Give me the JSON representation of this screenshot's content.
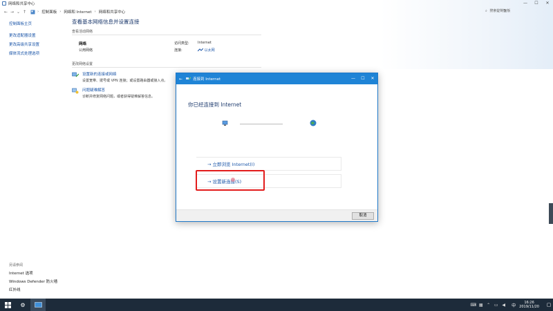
{
  "window": {
    "title": "网络和共享中心",
    "controls": {
      "minimize": "—",
      "maximize": "☐",
      "close": "✕"
    }
  },
  "address": {
    "back": "←",
    "forward": "→",
    "recent": "⌄",
    "up": "↑",
    "path": [
      "控制面板",
      "网络和 Internet",
      "网络和共享中心"
    ],
    "separator": "›",
    "dropdown": "⌄",
    "refresh": "↻",
    "search_placeholder": "搜索控制面板"
  },
  "sidebar": {
    "home": "控制面板主页",
    "items": [
      "更改适配器设置",
      "更改高级共享设置",
      "媒体流式处理选项"
    ],
    "see_also_title": "另请参阅",
    "see_also": [
      "Internet 选项",
      "Windows Defender 防火墙",
      "红外线"
    ]
  },
  "main": {
    "title": "查看基本网络信息并设置连接",
    "active_label": "查看活动网络",
    "network_name": "网络",
    "network_type": "公用网络",
    "access_type_key": "访问类型:",
    "access_type_value": "Internet",
    "connection_key": "连接:",
    "connection_value": "以太网",
    "change_label": "更改网络设置",
    "tasks": [
      {
        "title": "设置新的连接或网络",
        "desc": "设置宽带、拨号或 VPN 连接；或设置路由器或接入点。"
      },
      {
        "title": "问题疑难解答",
        "desc": "诊断并修复网络问题，或者获得疑难解答信息。"
      }
    ]
  },
  "dialog": {
    "title": "连接到 Internet",
    "back": "←",
    "controls": {
      "minimize": "—",
      "maximize": "☐",
      "close": "✕"
    },
    "heading": "你已经连接到 Internet",
    "options": [
      "→ 立即浏览 Internet(I)",
      "→ 设置新连接(S)"
    ],
    "cancel_label": "取消"
  },
  "taskbar": {
    "tray_lang": "中",
    "time": "16:26",
    "date": "2019/11/20"
  },
  "colors": {
    "accent": "#1f84d6",
    "link": "#1a55a8",
    "highlight": "#e21b1b",
    "taskbar": "#1d2b3a"
  }
}
